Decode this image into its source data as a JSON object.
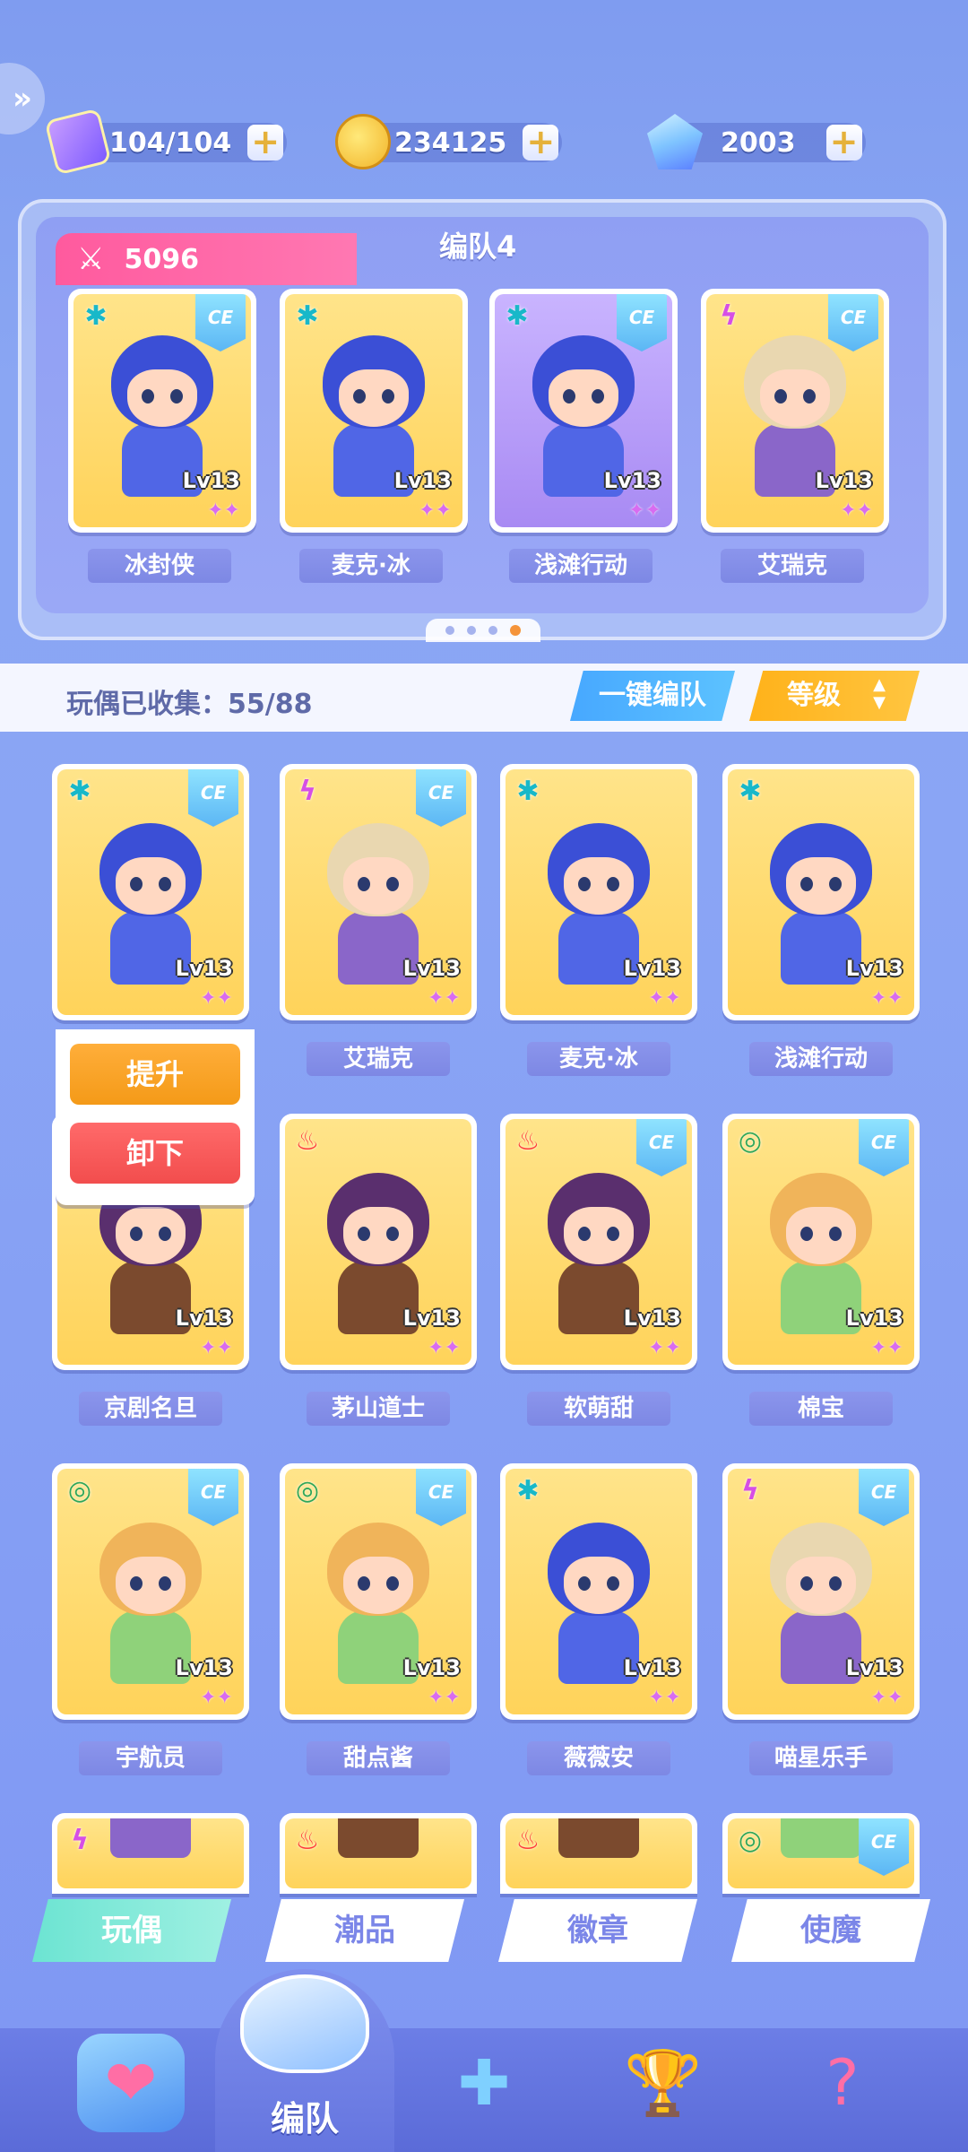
{
  "currencies": [
    {
      "name": "energy",
      "value": "104/104",
      "icon": "energy-ticket-icon"
    },
    {
      "name": "coins",
      "value": "234125",
      "icon": "coin-icon"
    },
    {
      "name": "gems",
      "value": "2003",
      "icon": "gem-icon"
    }
  ],
  "plus_symbol": "+",
  "team": {
    "power": "5096",
    "name": "编队4",
    "members": [
      {
        "name": "冰封侠",
        "level": "Lv13",
        "element": "ice",
        "ce": true
      },
      {
        "name": "麦克·冰",
        "level": "Lv13",
        "element": "ice",
        "ce": false
      },
      {
        "name": "浅滩行动",
        "level": "Lv13",
        "element": "ice",
        "ce": true
      },
      {
        "name": "艾瑞克",
        "level": "Lv13",
        "element": "bolt",
        "ce": true
      }
    ],
    "page_dots": 4,
    "active_dot": 4
  },
  "collection": {
    "label": "玩偶已收集：55/88",
    "auto_button": "一键编队",
    "sort_button": "等级"
  },
  "popup": {
    "upgrade": "提升",
    "unequip": "卸下"
  },
  "dolls": [
    {
      "name": "",
      "level": "Lv13",
      "element": "ice",
      "ce": true
    },
    {
      "name": "艾瑞克",
      "level": "Lv13",
      "element": "bolt",
      "ce": true
    },
    {
      "name": "麦克·冰",
      "level": "Lv13",
      "element": "ice",
      "ce": false
    },
    {
      "name": "浅滩行动",
      "level": "Lv13",
      "element": "ice",
      "ce": false
    },
    {
      "name": "京剧名旦",
      "level": "Lv13",
      "element": "fire",
      "ce": false
    },
    {
      "name": "茅山道士",
      "level": "Lv13",
      "element": "fire",
      "ce": false
    },
    {
      "name": "软萌甜",
      "level": "Lv13",
      "element": "fire",
      "ce": true
    },
    {
      "name": "棉宝",
      "level": "Lv13",
      "element": "wind",
      "ce": true
    },
    {
      "name": "宇航员",
      "level": "Lv13",
      "element": "wind",
      "ce": true
    },
    {
      "name": "甜点酱",
      "level": "Lv13",
      "element": "wind",
      "ce": true
    },
    {
      "name": "薇薇安",
      "level": "Lv13",
      "element": "ice",
      "ce": false
    },
    {
      "name": "喵星乐手",
      "level": "Lv13",
      "element": "bolt",
      "ce": true
    },
    {
      "name": "",
      "level": "",
      "element": "bolt",
      "ce": false
    },
    {
      "name": "",
      "level": "",
      "element": "fire",
      "ce": false
    },
    {
      "name": "",
      "level": "",
      "element": "fire",
      "ce": false
    },
    {
      "name": "",
      "level": "",
      "element": "wind",
      "ce": true
    }
  ],
  "category_tabs": [
    {
      "label": "玩偶",
      "active": true
    },
    {
      "label": "潮品",
      "active": false
    },
    {
      "label": "徽章",
      "active": false
    },
    {
      "label": "使魔",
      "active": false
    }
  ],
  "nav": {
    "center_label": "编队",
    "items": [
      "home-icon",
      "formation-whistle-icon",
      "puzzle-icon",
      "trophy-icon",
      "mystery-machine-icon"
    ]
  },
  "element_icons": {
    "ice": "✱",
    "bolt": "ϟ",
    "fire": "♨",
    "wind": "◎"
  },
  "ce_text": "CE",
  "stars_text": "✦✦",
  "colors": {
    "power_tab": "#ff5a9e",
    "auto_button": "#47a8ff",
    "sort_button": "#ffb21a",
    "upgrade_button": "#f49a18",
    "unequip_button": "#f24d4d",
    "active_tab": "#6ce4d2"
  }
}
